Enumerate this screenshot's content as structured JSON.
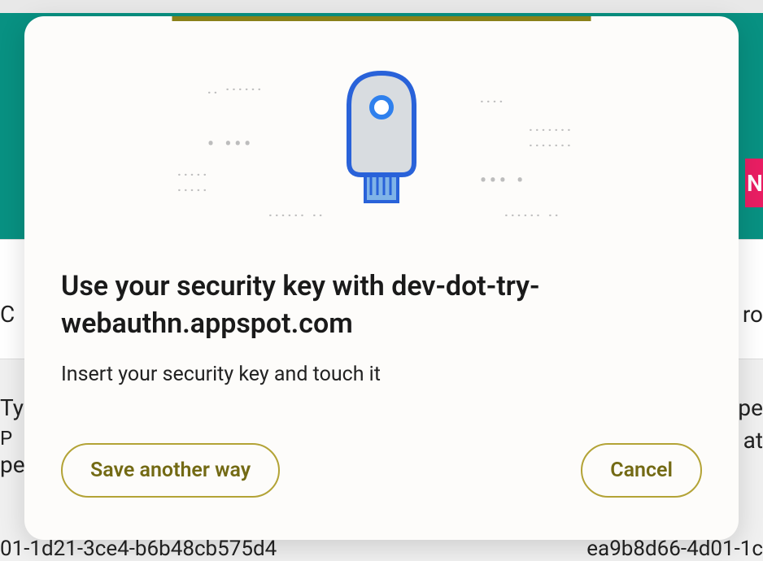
{
  "background": {
    "pink_badge": "N",
    "left_char": "C",
    "right_char": "ro",
    "left_ty": "Ty",
    "left_p": "P",
    "left_pe": "pe",
    "right_pe": "pe",
    "right_at": "at",
    "hash1": "01-1d21-3ce4-b6b48cb575d4",
    "hash2": "ea9b8d66-4d01-1c"
  },
  "modal": {
    "title": "Use your security key with dev-dot-try-webauthn.appspot.com",
    "subtitle": "Insert your security key and touch it",
    "save_label": "Save another way",
    "cancel_label": "Cancel"
  }
}
